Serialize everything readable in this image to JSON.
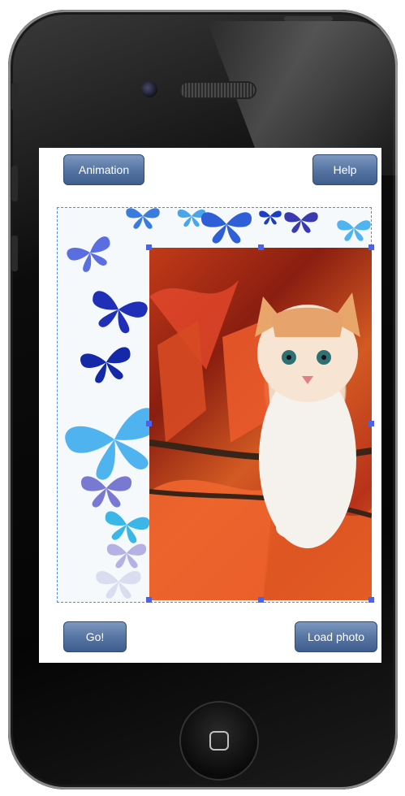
{
  "app": {
    "buttons": {
      "animation": "Animation",
      "help": "Help",
      "go": "Go!",
      "load_photo": "Load photo"
    }
  },
  "colors": {
    "button_top": "#7c97bf",
    "button_bottom": "#3e5d8d",
    "selection_border": "#4a8ee0",
    "handle": "#4b63e6",
    "butterfly_blue": "#2f5fd6",
    "butterfly_light": "#4fb3f0",
    "autumn_red": "#c23a18"
  },
  "icons": {
    "home": "home-button-icon",
    "camera": "camera-icon",
    "speaker": "speaker-grille-icon"
  }
}
